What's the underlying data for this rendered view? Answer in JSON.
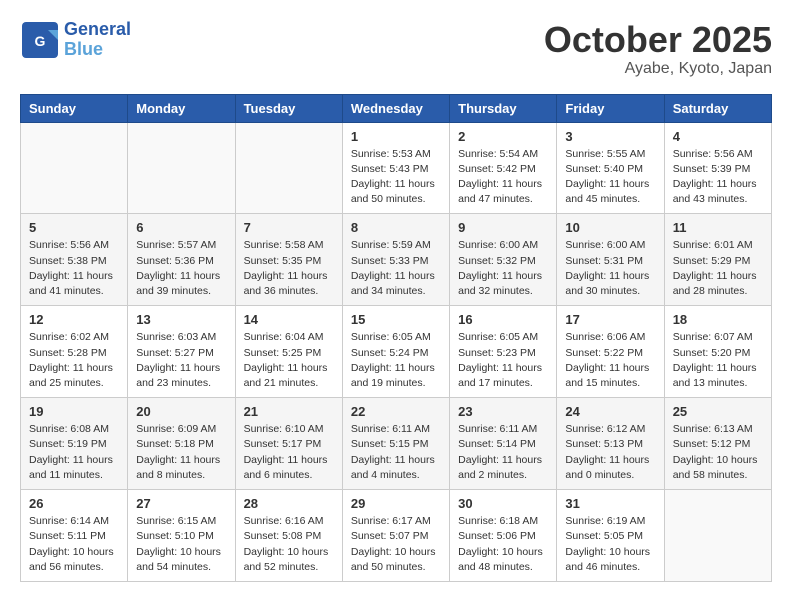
{
  "header": {
    "logo_line1": "General",
    "logo_line2": "Blue",
    "title": "October 2025",
    "subtitle": "Ayabe, Kyoto, Japan"
  },
  "weekdays": [
    "Sunday",
    "Monday",
    "Tuesday",
    "Wednesday",
    "Thursday",
    "Friday",
    "Saturday"
  ],
  "weeks": [
    [
      {
        "day": "",
        "info": ""
      },
      {
        "day": "",
        "info": ""
      },
      {
        "day": "",
        "info": ""
      },
      {
        "day": "1",
        "info": "Sunrise: 5:53 AM\nSunset: 5:43 PM\nDaylight: 11 hours\nand 50 minutes."
      },
      {
        "day": "2",
        "info": "Sunrise: 5:54 AM\nSunset: 5:42 PM\nDaylight: 11 hours\nand 47 minutes."
      },
      {
        "day": "3",
        "info": "Sunrise: 5:55 AM\nSunset: 5:40 PM\nDaylight: 11 hours\nand 45 minutes."
      },
      {
        "day": "4",
        "info": "Sunrise: 5:56 AM\nSunset: 5:39 PM\nDaylight: 11 hours\nand 43 minutes."
      }
    ],
    [
      {
        "day": "5",
        "info": "Sunrise: 5:56 AM\nSunset: 5:38 PM\nDaylight: 11 hours\nand 41 minutes."
      },
      {
        "day": "6",
        "info": "Sunrise: 5:57 AM\nSunset: 5:36 PM\nDaylight: 11 hours\nand 39 minutes."
      },
      {
        "day": "7",
        "info": "Sunrise: 5:58 AM\nSunset: 5:35 PM\nDaylight: 11 hours\nand 36 minutes."
      },
      {
        "day": "8",
        "info": "Sunrise: 5:59 AM\nSunset: 5:33 PM\nDaylight: 11 hours\nand 34 minutes."
      },
      {
        "day": "9",
        "info": "Sunrise: 6:00 AM\nSunset: 5:32 PM\nDaylight: 11 hours\nand 32 minutes."
      },
      {
        "day": "10",
        "info": "Sunrise: 6:00 AM\nSunset: 5:31 PM\nDaylight: 11 hours\nand 30 minutes."
      },
      {
        "day": "11",
        "info": "Sunrise: 6:01 AM\nSunset: 5:29 PM\nDaylight: 11 hours\nand 28 minutes."
      }
    ],
    [
      {
        "day": "12",
        "info": "Sunrise: 6:02 AM\nSunset: 5:28 PM\nDaylight: 11 hours\nand 25 minutes."
      },
      {
        "day": "13",
        "info": "Sunrise: 6:03 AM\nSunset: 5:27 PM\nDaylight: 11 hours\nand 23 minutes."
      },
      {
        "day": "14",
        "info": "Sunrise: 6:04 AM\nSunset: 5:25 PM\nDaylight: 11 hours\nand 21 minutes."
      },
      {
        "day": "15",
        "info": "Sunrise: 6:05 AM\nSunset: 5:24 PM\nDaylight: 11 hours\nand 19 minutes."
      },
      {
        "day": "16",
        "info": "Sunrise: 6:05 AM\nSunset: 5:23 PM\nDaylight: 11 hours\nand 17 minutes."
      },
      {
        "day": "17",
        "info": "Sunrise: 6:06 AM\nSunset: 5:22 PM\nDaylight: 11 hours\nand 15 minutes."
      },
      {
        "day": "18",
        "info": "Sunrise: 6:07 AM\nSunset: 5:20 PM\nDaylight: 11 hours\nand 13 minutes."
      }
    ],
    [
      {
        "day": "19",
        "info": "Sunrise: 6:08 AM\nSunset: 5:19 PM\nDaylight: 11 hours\nand 11 minutes."
      },
      {
        "day": "20",
        "info": "Sunrise: 6:09 AM\nSunset: 5:18 PM\nDaylight: 11 hours\nand 8 minutes."
      },
      {
        "day": "21",
        "info": "Sunrise: 6:10 AM\nSunset: 5:17 PM\nDaylight: 11 hours\nand 6 minutes."
      },
      {
        "day": "22",
        "info": "Sunrise: 6:11 AM\nSunset: 5:15 PM\nDaylight: 11 hours\nand 4 minutes."
      },
      {
        "day": "23",
        "info": "Sunrise: 6:11 AM\nSunset: 5:14 PM\nDaylight: 11 hours\nand 2 minutes."
      },
      {
        "day": "24",
        "info": "Sunrise: 6:12 AM\nSunset: 5:13 PM\nDaylight: 11 hours\nand 0 minutes."
      },
      {
        "day": "25",
        "info": "Sunrise: 6:13 AM\nSunset: 5:12 PM\nDaylight: 10 hours\nand 58 minutes."
      }
    ],
    [
      {
        "day": "26",
        "info": "Sunrise: 6:14 AM\nSunset: 5:11 PM\nDaylight: 10 hours\nand 56 minutes."
      },
      {
        "day": "27",
        "info": "Sunrise: 6:15 AM\nSunset: 5:10 PM\nDaylight: 10 hours\nand 54 minutes."
      },
      {
        "day": "28",
        "info": "Sunrise: 6:16 AM\nSunset: 5:08 PM\nDaylight: 10 hours\nand 52 minutes."
      },
      {
        "day": "29",
        "info": "Sunrise: 6:17 AM\nSunset: 5:07 PM\nDaylight: 10 hours\nand 50 minutes."
      },
      {
        "day": "30",
        "info": "Sunrise: 6:18 AM\nSunset: 5:06 PM\nDaylight: 10 hours\nand 48 minutes."
      },
      {
        "day": "31",
        "info": "Sunrise: 6:19 AM\nSunset: 5:05 PM\nDaylight: 10 hours\nand 46 minutes."
      },
      {
        "day": "",
        "info": ""
      }
    ]
  ]
}
